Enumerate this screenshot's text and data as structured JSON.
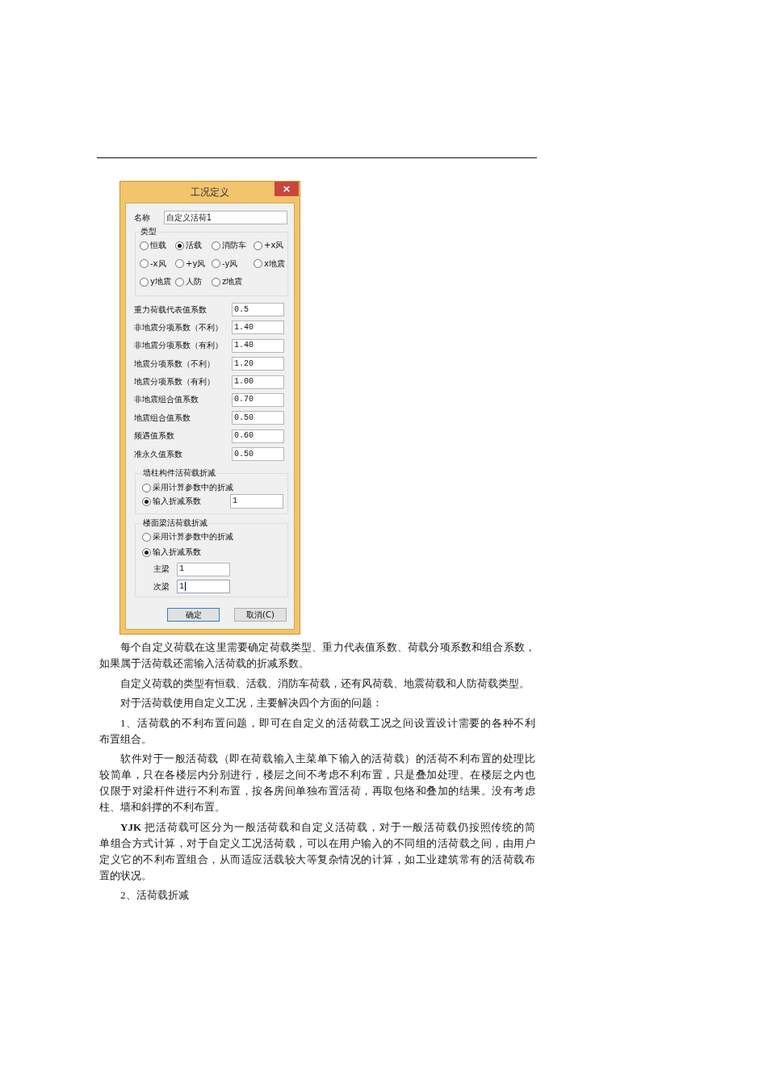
{
  "dialog": {
    "title": "工况定义",
    "close_button": "×",
    "name_field": {
      "label": "名称",
      "value": "自定义活荷1"
    },
    "type_group": {
      "title": "类型",
      "options": [
        {
          "label": "恒载",
          "selected": false
        },
        {
          "label": "活载",
          "selected": true
        },
        {
          "label": "消防车",
          "selected": false
        },
        {
          "label": "+x风",
          "selected": false
        },
        {
          "label": "-x风",
          "selected": false
        },
        {
          "label": "+y风",
          "selected": false
        },
        {
          "label": "-y风",
          "selected": false
        },
        {
          "label": "x地震",
          "selected": false
        },
        {
          "label": "y地震",
          "selected": false
        },
        {
          "label": "人防",
          "selected": false
        },
        {
          "label": "z地震",
          "selected": false
        }
      ]
    },
    "coefficients": [
      {
        "label": "重力荷载代表值系数",
        "value": "0.5"
      },
      {
        "label": "非地震分项系数（不利）",
        "value": "1.40"
      },
      {
        "label": "非地震分项系数（有利）",
        "value": "1.40"
      },
      {
        "label": "地震分项系数（不利）",
        "value": "1.20"
      },
      {
        "label": "地震分项系数（有利）",
        "value": "1.00"
      },
      {
        "label": "非地震组合值系数",
        "value": "0.70"
      },
      {
        "label": "地震组合值系数",
        "value": "0.50"
      },
      {
        "label": "频遇值系数",
        "value": "0.60"
      },
      {
        "label": "准永久值系数",
        "value": "0.50"
      }
    ],
    "reduction_groups": [
      {
        "title": "墙柱构件活荷载折减",
        "options": [
          {
            "label": "采用计算参数中的折减",
            "selected": false
          },
          {
            "label": "输入折减系数",
            "selected": true,
            "value": "1"
          }
        ]
      },
      {
        "title": "楼面梁活荷载折减",
        "options": [
          {
            "label": "采用计算参数中的折减",
            "selected": false
          },
          {
            "label": "输入折减系数",
            "selected": true
          }
        ],
        "fields": [
          {
            "label": "主梁",
            "value": "1",
            "focused": false
          },
          {
            "label": "次梁",
            "value": "1",
            "focused": true
          }
        ]
      }
    ],
    "buttons": [
      {
        "label": "确定",
        "default": true
      },
      {
        "label": "取消(C)",
        "default": false
      }
    ]
  },
  "article": {
    "paragraphs": [
      {
        "lines": [
          "每个自定义荷载在这里需要确定荷载类型、重力代表值系数、荷载分项系数和组合系数，",
          "如果属于活荷载还需输入活荷载的折减系数。"
        ]
      },
      {
        "lines": [
          "自定义荷载的类型有恒载、活载、消防车荷载，还有风荷载、地震荷载和人防荷载类型。"
        ]
      },
      {
        "lines": [
          "对于活荷载使用自定义工况，主要解决四个方面的问题："
        ]
      },
      {
        "lines": [
          "1、活荷载的不利布置问题，即可在自定义的活荷载工况之间设置设计需要的各种不利",
          "布置组合。"
        ]
      },
      {
        "lines": [
          "软件对于一般活荷载（即在荷载输入主菜单下输入的活荷载）的活荷不利布置的处理比",
          "较简单，只在各楼层内分别进行，楼层之间不考虑不利布置，只是叠加处理。在楼层之内也",
          "仅限于对梁杆件进行不利布置，按各房间单独布置活荷，再取包络和叠加的结果。没有考虑",
          "柱、墙和斜撑的不利布置。"
        ]
      },
      {
        "lines": [
          "**YJK** 把活荷载可区分为一般活荷载和自定义活荷载，对于一般活荷载仍按照传统的简",
          "单组合方式计算，对于自定义工况活荷载，可以在用户输入的不同组的活荷载之间，由用户",
          "定义它的不利布置组合，从而适应活载较大等复杂情况的计算，如工业建筑常有的活荷载布",
          "置的状况。"
        ]
      },
      {
        "lines": [
          "2、活荷载折减"
        ]
      }
    ]
  }
}
